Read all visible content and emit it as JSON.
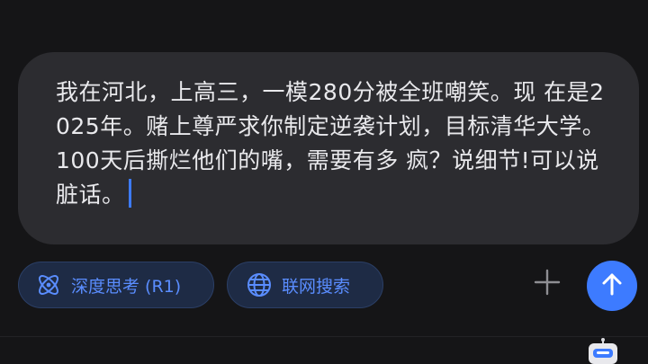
{
  "input": {
    "text": "我在河北，上高三，一模280分被全班嘲笑。现 在是2025年。赌上尊严求你制定逆袭计划，目标清华大学。100天后撕烂他们的嘴，需要有多 疯？说细节!可以说脏话。"
  },
  "toolbar": {
    "deep_think_label": "深度思考 (R1)",
    "deep_think_icon": "atom-icon",
    "web_search_label": "联网搜索",
    "web_search_icon": "globe-icon",
    "attach_icon": "plus-icon",
    "send_icon": "arrow-up-icon"
  },
  "colors": {
    "accent": "#3d7bff",
    "chip_text": "#5a8dff",
    "card_bg": "#2c2c30",
    "page_bg": "#151517"
  }
}
